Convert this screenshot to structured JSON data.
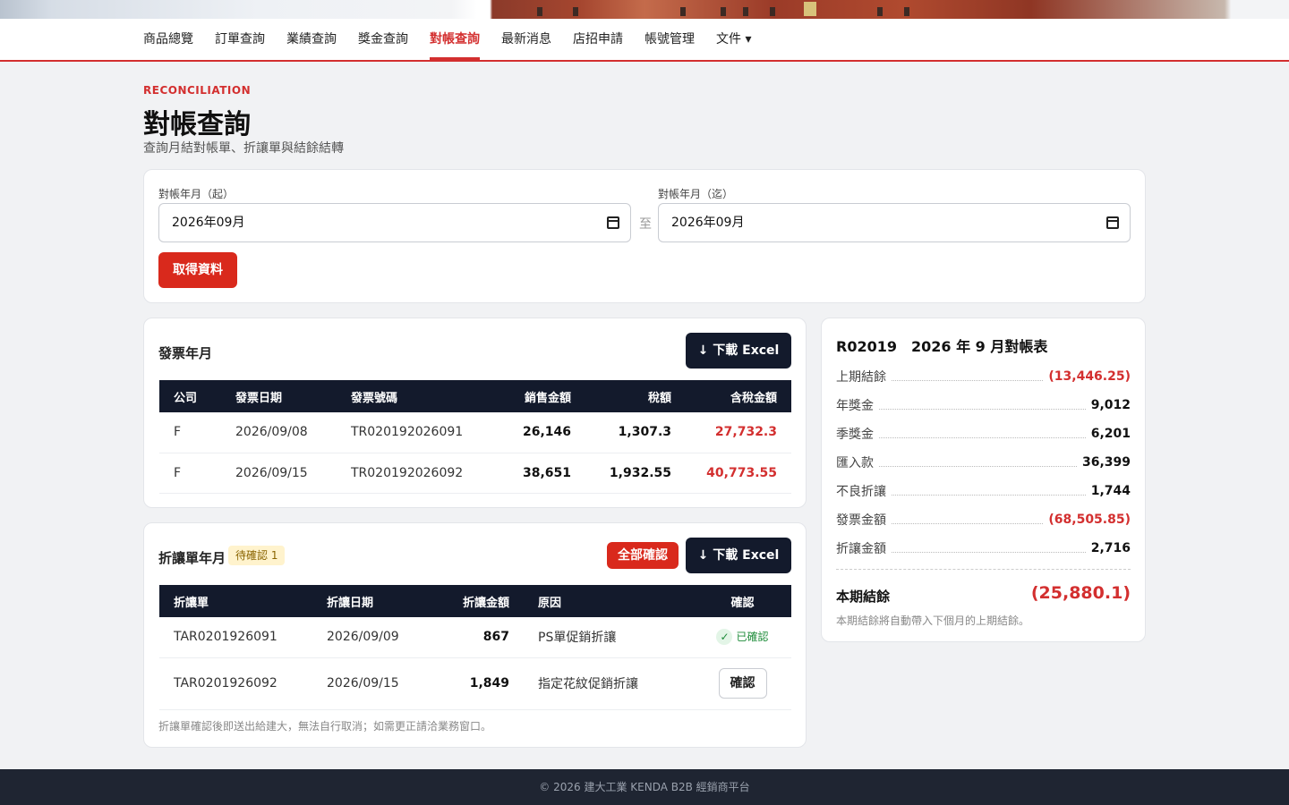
{
  "nav": {
    "items": [
      "商品總覽",
      "訂單查詢",
      "業績查詢",
      "獎金查詢",
      "對帳查詢",
      "最新消息",
      "店招申請",
      "帳號管理",
      "文件 ▾"
    ],
    "active_index": 4
  },
  "header": {
    "eyebrow": "RECONCILIATION",
    "title": "對帳查詢",
    "subtitle": "查詢月結對帳單、折讓單與結餘結轉"
  },
  "filter": {
    "start_label": "對帳年月（起）",
    "start_value": "2026年09月",
    "separator": "至",
    "end_label": "對帳年月（迄）",
    "end_value": "2026年09月",
    "fetch_button": "取得資料"
  },
  "invoice": {
    "title": "發票年月",
    "download_button": "↓ 下載 Excel",
    "columns": [
      "公司",
      "發票日期",
      "發票號碼",
      "銷售金額",
      "稅額",
      "含稅金額"
    ],
    "rows": [
      {
        "company": "F",
        "date": "2026/09/08",
        "number": "TR020192026091",
        "sales": "26,146",
        "tax": "1,307.3",
        "total": "27,732.3"
      },
      {
        "company": "F",
        "date": "2026/09/15",
        "number": "TR020192026092",
        "sales": "38,651",
        "tax": "1,932.55",
        "total": "40,773.55"
      }
    ]
  },
  "allowance": {
    "title": "折讓單年月",
    "pending_badge": "待確認 1",
    "confirm_all_button": "全部確認",
    "download_button": "↓ 下載 Excel",
    "columns": [
      "折讓單",
      "折讓日期",
      "折讓金額",
      "原因",
      "確認"
    ],
    "rows": [
      {
        "id": "TAR0201926091",
        "date": "2026/09/09",
        "amount": "867",
        "reason": "PS單促銷折讓",
        "status": "已確認"
      },
      {
        "id": "TAR0201926092",
        "date": "2026/09/15",
        "amount": "1,849",
        "reason": "指定花紋促銷折讓",
        "status": "確認"
      }
    ],
    "note": "折讓單確認後即送出給建大，無法自行取消；如需更正請洽業務窗口。"
  },
  "summary": {
    "title": "R02019　2026 年 9 月對帳表",
    "rows": [
      {
        "label": "上期結餘",
        "value": "(13,446.25)",
        "negative": true
      },
      {
        "label": "年獎金",
        "value": "9,012",
        "negative": false
      },
      {
        "label": "季獎金",
        "value": "6,201",
        "negative": false
      },
      {
        "label": "匯入款",
        "value": "36,399",
        "negative": false
      },
      {
        "label": "不良折讓",
        "value": "1,744",
        "negative": false
      },
      {
        "label": "發票金額",
        "value": "(68,505.85)",
        "negative": true
      },
      {
        "label": "折讓金額",
        "value": "2,716",
        "negative": false
      }
    ],
    "final_label": "本期結餘",
    "final_value": "(25,880.1)",
    "note": "本期結餘將自動帶入下個月的上期結餘。"
  },
  "footer": {
    "text": "© 2026 建大工業 KENDA B2B 經銷商平台"
  },
  "colors": {
    "accent": "#d32f2f",
    "dark": "#131a2c",
    "success": "#1e8c3a"
  }
}
